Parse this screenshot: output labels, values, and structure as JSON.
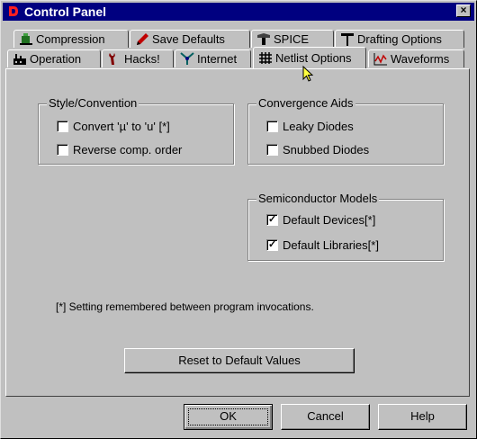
{
  "window": {
    "title": "Control Panel",
    "close_label": "×"
  },
  "tabs_back": [
    {
      "label": "Compression",
      "icon": "compression-icon"
    },
    {
      "label": "Save Defaults",
      "icon": "pencil-icon"
    },
    {
      "label": "SPICE",
      "icon": "spice-icon"
    },
    {
      "label": "Drafting Options",
      "icon": "drafting-icon"
    }
  ],
  "tabs_front": [
    {
      "label": "Operation",
      "icon": "factory-icon"
    },
    {
      "label": "Hacks!",
      "icon": "wrench-icon"
    },
    {
      "label": "Internet",
      "icon": "internet-icon"
    },
    {
      "label": "Netlist Options",
      "icon": "grid-icon",
      "active": true
    },
    {
      "label": "Waveforms",
      "icon": "waveform-icon"
    }
  ],
  "groups": {
    "style": {
      "title": "Style/Convention",
      "items": [
        {
          "label": "Convert 'µ' to 'u' [*]",
          "checked": false
        },
        {
          "label": "Reverse comp. order",
          "checked": false
        }
      ]
    },
    "convergence": {
      "title": "Convergence Aids",
      "items": [
        {
          "label": "Leaky Diodes",
          "checked": false
        },
        {
          "label": "Snubbed Diodes",
          "checked": false
        }
      ]
    },
    "semiconductor": {
      "title": "Semiconductor Models",
      "items": [
        {
          "label": "Default Devices[*]",
          "checked": true
        },
        {
          "label": "Default Libraries[*]",
          "checked": true
        }
      ]
    }
  },
  "note": "[*] Setting remembered between program invocations.",
  "buttons": {
    "reset": "Reset to Default Values",
    "ok": "OK",
    "cancel": "Cancel",
    "help": "Help"
  },
  "colors": {
    "titlebar": "#000080",
    "face": "#c0c0c0"
  }
}
